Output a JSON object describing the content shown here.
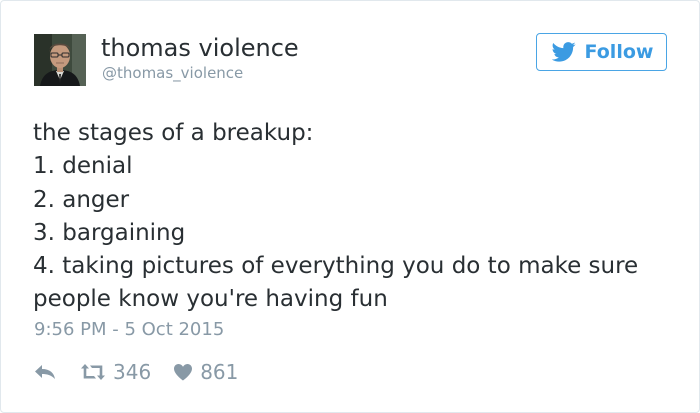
{
  "user": {
    "name": "thomas violence",
    "handle": "@thomas_violence"
  },
  "follow_label": "Follow",
  "tweet": {
    "lines": [
      "the stages of a breakup:",
      "1. denial",
      "2. anger",
      "3. bargaining",
      "4. taking pictures of everything you do to make sure",
      "people know you're having fun"
    ],
    "timestamp": "9:56 PM - 5 Oct 2015"
  },
  "actions": {
    "retweets": "346",
    "likes": "861"
  },
  "icons": {
    "follow": "twitter-bird-icon",
    "reply": "reply-arrow-icon",
    "retweet": "retweet-icon",
    "like": "heart-icon"
  },
  "colors": {
    "accent": "#3b9be2",
    "text": "#292f33",
    "muted": "#8899a6",
    "border": "#e1e8ed"
  }
}
